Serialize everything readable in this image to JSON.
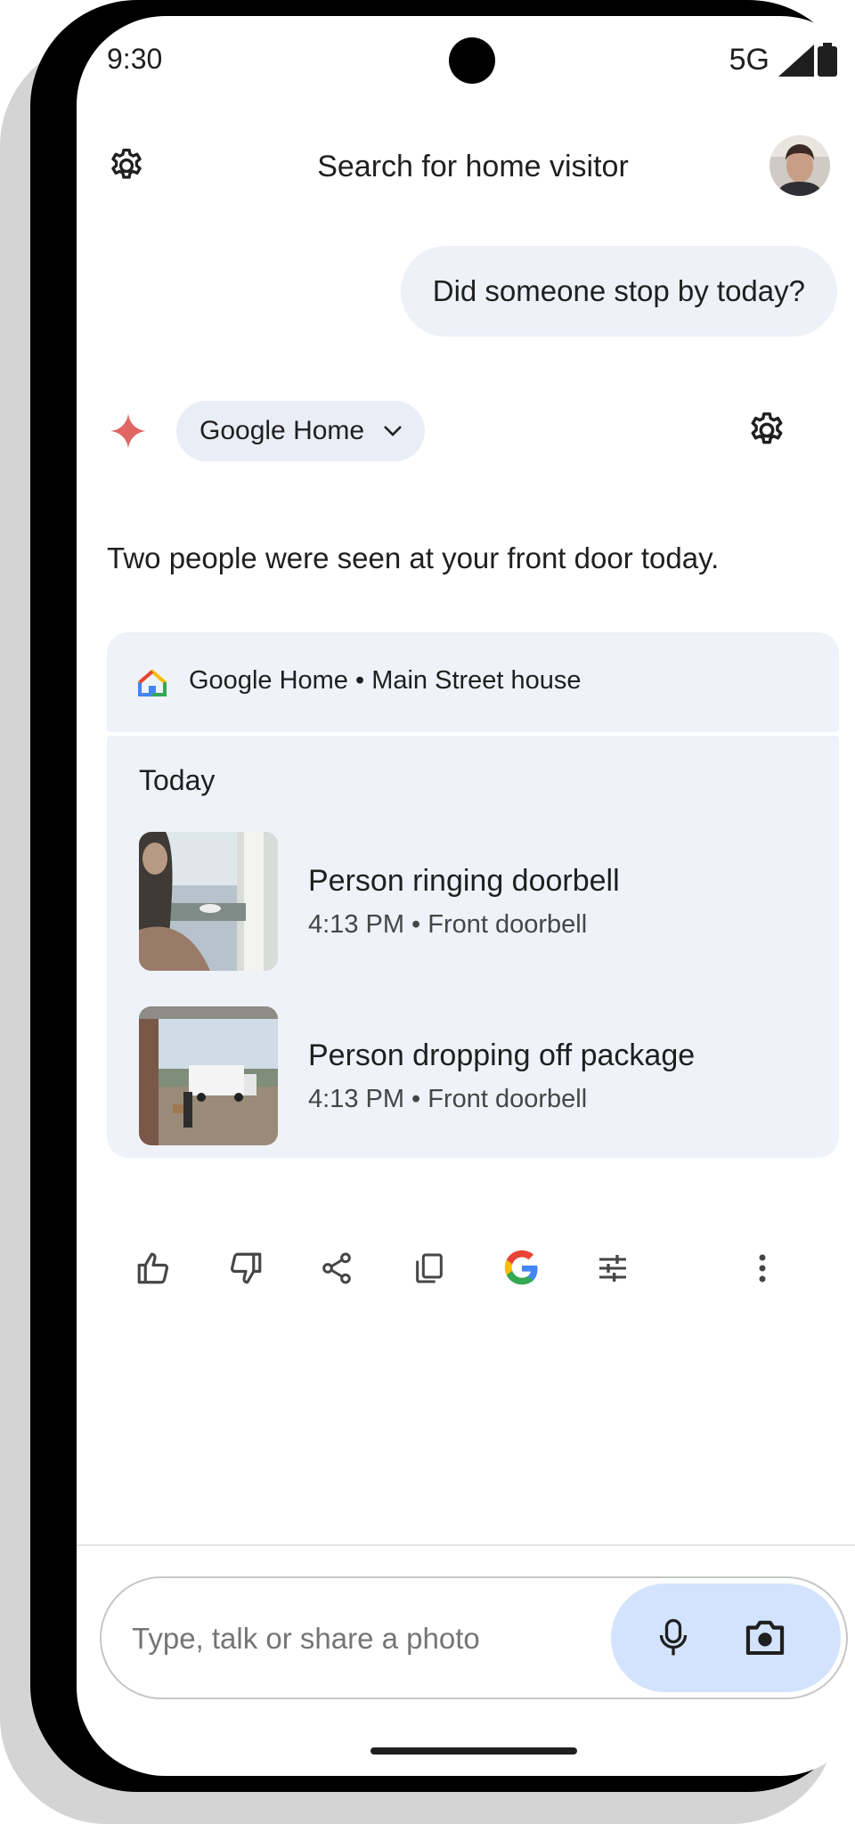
{
  "status_bar": {
    "time": "9:30",
    "network": "5G"
  },
  "top_bar": {
    "title": "Search for home visitor"
  },
  "user_message": "Did someone stop by today?",
  "assistant": {
    "source_chip": "Google Home",
    "answer": "Two people were seen at your front door today."
  },
  "card": {
    "header": "Google Home • Main Street house",
    "section": "Today",
    "events": [
      {
        "title": "Person ringing doorbell",
        "subtitle": "4:13 PM • Front doorbell"
      },
      {
        "title": "Person dropping off package",
        "subtitle": "4:13 PM • Front doorbell"
      }
    ]
  },
  "actions": [
    "thumbs-up-icon",
    "thumbs-down-icon",
    "share-icon",
    "copy-icon",
    "google-g-icon",
    "tune-icon",
    "more-vert-icon"
  ],
  "input": {
    "placeholder": "Type, talk or share a photo"
  },
  "colors": {
    "bubble": "#eef1f8",
    "card": "#eff2f8",
    "pill": "#d3e3fd",
    "spark": "#e06666"
  }
}
